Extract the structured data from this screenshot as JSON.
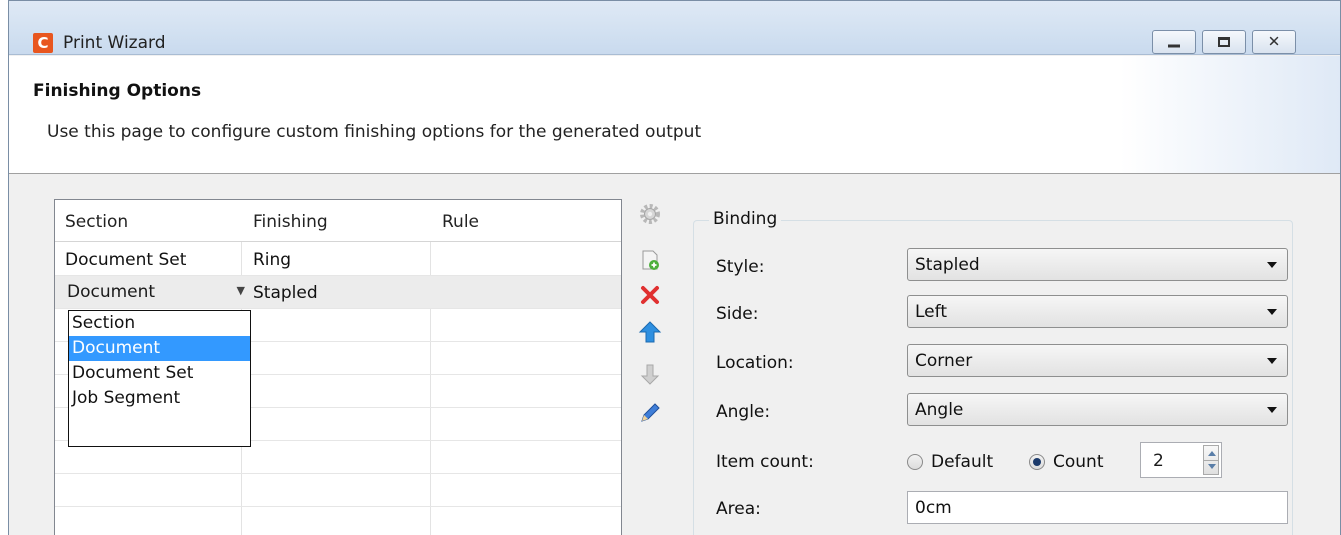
{
  "window": {
    "title": "Print Wizard",
    "app_icon_letter": "C",
    "accent_color": "#e8561f",
    "controls": [
      "minimize",
      "maximize",
      "close"
    ]
  },
  "page": {
    "title": "Finishing Options",
    "description": "Use this page to configure custom finishing options for the generated output"
  },
  "table": {
    "columns": [
      "Section",
      "Finishing",
      "Rule"
    ],
    "rows": [
      {
        "section": "Document Set",
        "finishing": "Ring",
        "rule": ""
      },
      {
        "section": "Document",
        "finishing": "Stapled",
        "rule": ""
      }
    ],
    "editor": {
      "value": "Document",
      "options": [
        "Section",
        "Document",
        "Document Set",
        "Job Segment"
      ],
      "highlighted": "Document"
    }
  },
  "toolbar": {
    "icons": [
      "gear-icon",
      "add-icon",
      "delete-icon",
      "move-up-icon",
      "move-down-icon",
      "edit-icon"
    ]
  },
  "binding": {
    "group_label": "Binding",
    "style_label": "Style:",
    "style_value": "Stapled",
    "side_label": "Side:",
    "side_value": "Left",
    "location_label": "Location:",
    "location_value": "Corner",
    "angle_label": "Angle:",
    "angle_value": "Angle",
    "item_count_label": "Item count:",
    "default_label": "Default",
    "count_label": "Count",
    "count_selected": "Count",
    "count_value": "2",
    "area_label": "Area:",
    "area_value": "0cm"
  },
  "colors": {
    "selection": "#3399ff",
    "delete": "#e03030",
    "arrow_up": "#2e8fe0"
  }
}
